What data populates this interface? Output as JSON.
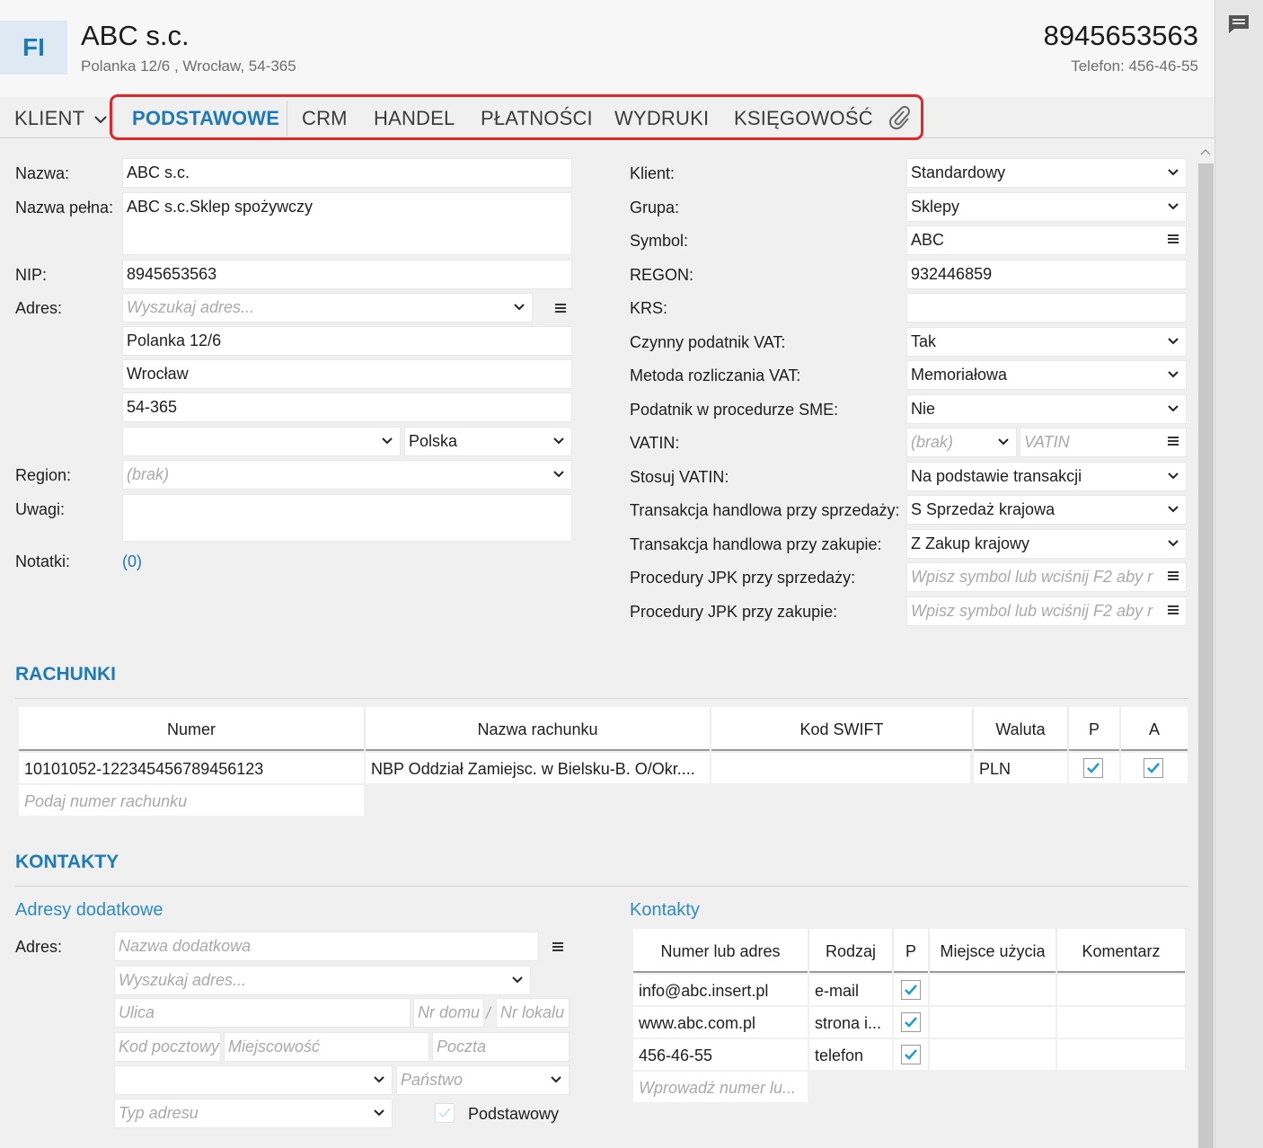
{
  "header": {
    "logo": "FI",
    "title": "ABC s.c.",
    "subtitle": "Polanka  12/6 , Wrocław, 54-365",
    "nip": "8945653563",
    "phone": "Telefon: 456-46-55"
  },
  "nav": {
    "client_label": "KLIENT",
    "tabs": [
      {
        "label": "PODSTAWOWE",
        "active": true
      },
      {
        "label": "CRM"
      },
      {
        "label": "HANDEL"
      },
      {
        "label": "PŁATNOŚCI"
      },
      {
        "label": "WYDRUKI"
      },
      {
        "label": "KSIĘGOWOŚĆ"
      }
    ],
    "attach_icon": "paperclip-icon"
  },
  "left_form": {
    "nazwa_label": "Nazwa:",
    "nazwa": "ABC s.c.",
    "nazwa_pelna_label": "Nazwa pełna:",
    "nazwa_pelna": "ABC s.c.Sklep spożywczy",
    "nip_label": "NIP:",
    "nip": "8945653563",
    "adres_label": "Adres:",
    "adres_placeholder": "Wyszukaj adres...",
    "ulica": "Polanka  12/6",
    "miasto": "Wrocław",
    "kod": "54-365",
    "panstwo": "Polska",
    "region_label": "Region:",
    "region": "(brak)",
    "uwagi_label": "Uwagi:",
    "notatki_label": "Notatki:",
    "notatki": "(0)"
  },
  "right_form": {
    "klient_label": "Klient:",
    "klient": "Standardowy",
    "grupa_label": "Grupa:",
    "grupa": "Sklepy",
    "symbol_label": "Symbol:",
    "symbol": "ABC",
    "regon_label": "REGON:",
    "regon": "932446859",
    "krs_label": "KRS:",
    "vat_label": "Czynny podatnik VAT:",
    "vat": "Tak",
    "metoda_label": "Metoda rozliczania VAT:",
    "metoda": "Memoriałowa",
    "sme_label": "Podatnik w procedurze SME:",
    "sme": "Nie",
    "vatin_label": "VATIN:",
    "vatin_country": "(brak)",
    "vatin_placeholder": "VATIN",
    "stosuj_label": "Stosuj VATIN:",
    "stosuj": "Na podstawie transakcji",
    "trans_sprz_label": "Transakcja handlowa przy sprzedaży:",
    "trans_sprz": "S  Sprzedaż krajowa",
    "trans_zak_label": "Transakcja handlowa przy zakupie:",
    "trans_zak": "Z  Zakup krajowy",
    "jpk_sprz_label": "Procedury JPK przy sprzedaży:",
    "jpk_sprz_placeholder": "Wpisz symbol lub wciśnij F2 aby r",
    "jpk_zak_label": "Procedury JPK przy zakupie:",
    "jpk_zak_placeholder": "Wpisz symbol lub wciśnij F2 aby r"
  },
  "rachunki": {
    "title": "RACHUNKI",
    "headers": [
      "Numer",
      "Nazwa rachunku",
      "Kod SWIFT",
      "Waluta",
      "P",
      "A"
    ],
    "row": {
      "numer": "10101052-122345456789456123",
      "nazwa": "NBP Oddział Zamiejsc. w Bielsku-B.  O/Okr....",
      "swift": "",
      "waluta": "PLN",
      "p": true,
      "a": true
    },
    "placeholder": "Podaj numer rachunku"
  },
  "kontakty_section": {
    "title": "KONTAKTY",
    "adresy_title": "Adresy dodatkowe",
    "adres_label": "Adres:",
    "nazwa_dod_placeholder": "Nazwa dodatkowa",
    "wyszukaj_placeholder": "Wyszukaj adres...",
    "ulica_placeholder": "Ulica",
    "nr_domu_placeholder": "Nr domu",
    "slash": "/",
    "nr_lokalu_placeholder": "Nr lokalu",
    "kod_placeholder": "Kod pocztowy",
    "miejscowosc_placeholder": "Miejscowość",
    "poczta_placeholder": "Poczta",
    "panstwo_placeholder": "Państwo",
    "typ_placeholder": "Typ adresu",
    "podstawowy_label": "Podstawowy",
    "kontakty_title": "Kontakty",
    "headers": [
      "Numer lub adres",
      "Rodzaj",
      "P",
      "Miejsce użycia",
      "Komentarz"
    ],
    "rows": [
      {
        "numer": "info@abc.insert.pl",
        "rodzaj": "e-mail",
        "p": true
      },
      {
        "numer": "www.abc.com.pl",
        "rodzaj": "strona i...",
        "p": true
      },
      {
        "numer": "456-46-55",
        "rodzaj": "telefon",
        "p": true
      }
    ],
    "new_placeholder": "Wprowadź numer lu..."
  },
  "colors": {
    "accent": "#1f7ab8",
    "highlight_box": "#e2262a",
    "checkmark": "#1e9ad6"
  }
}
